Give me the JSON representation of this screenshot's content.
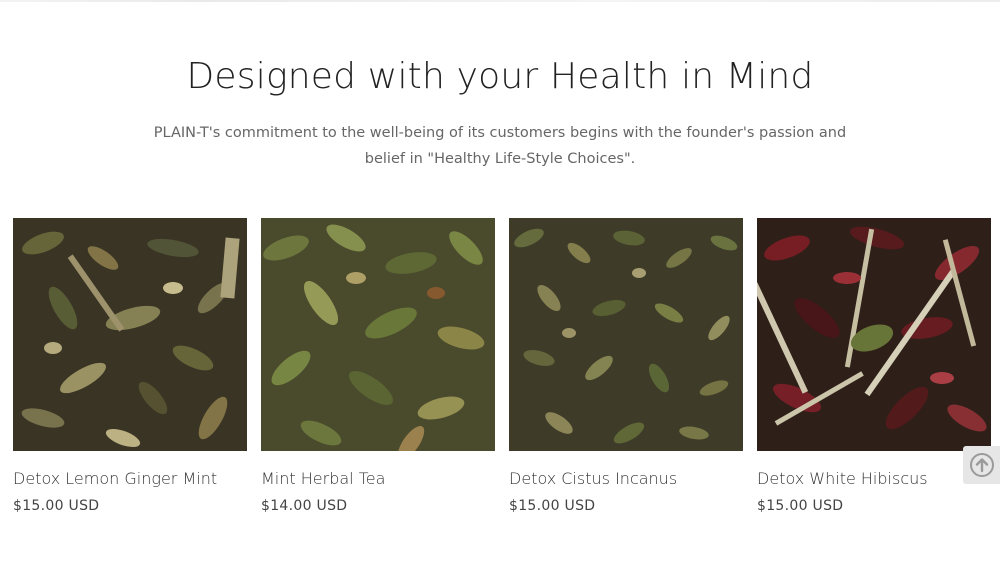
{
  "section": {
    "title": "Designed with your Health in Mind",
    "description": "PLAIN-T's commitment to the well-being of its customers begins with the founder's passion and belief in \"Healthy Life-Style Choices\"."
  },
  "products": [
    {
      "name": "Detox Lemon Ginger Mint",
      "price": "$15.00 USD",
      "image_icon": "tea-leaves-image"
    },
    {
      "name": "Mint Herbal Tea",
      "price": "$14.00 USD",
      "image_icon": "tea-leaves-image"
    },
    {
      "name": "Detox Cistus Incanus",
      "price": "$15.00 USD",
      "image_icon": "tea-leaves-image"
    },
    {
      "name": "Detox White Hibiscus",
      "price": "$15.00 USD",
      "image_icon": "tea-leaves-image"
    }
  ],
  "scroll_top": {
    "icon": "arrow-up-circle-icon"
  },
  "colors": {
    "title": "#222222",
    "body_text": "#666666",
    "price": "#444444"
  }
}
